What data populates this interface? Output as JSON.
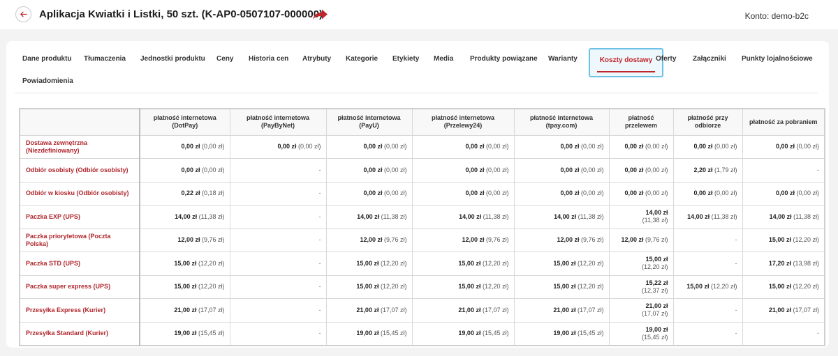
{
  "header": {
    "title": "Aplikacja Kwiatki i Listki, 50 szt. (K-AP0-0507107-000000)",
    "account": "Konto: demo-b2c",
    "back_icon": "arrow-left-icon",
    "share_icon": "share-arrow-icon",
    "accent": "#c0272d"
  },
  "tabs": [
    {
      "label": "Dane produktu"
    },
    {
      "label": "Tłumaczenia"
    },
    {
      "label": "Jednostki produktu"
    },
    {
      "label": "Ceny"
    },
    {
      "label": "Historia cen"
    },
    {
      "label": "Atrybuty"
    },
    {
      "label": "Kategorie"
    },
    {
      "label": "Etykiety"
    },
    {
      "label": "Media"
    },
    {
      "label": "Produkty powiązane"
    },
    {
      "label": "Warianty"
    },
    {
      "label": "Koszty dostawy",
      "active": true
    },
    {
      "label": "Oferty"
    },
    {
      "label": "Załączniki"
    },
    {
      "label": "Punkty lojalnościowe"
    },
    {
      "label": "Powiadomienia"
    }
  ],
  "table": {
    "columns": [
      "",
      "płatność internetowa (DotPay)",
      "płatność internetowa (PayByNet)",
      "płatność internetowa (PayU)",
      "płatność internetowa (Przelewy24)",
      "płatność internetowa (tpay.com)",
      "płatność przelewem",
      "płatność przy odbiorze",
      "płatność za pobraniem"
    ],
    "rows": [
      {
        "name": "Dostawa zewnętrzna (Niezdefiniowany)",
        "cells": [
          {
            "v": "0,00 zł",
            "n": "(0,00 zł)"
          },
          {
            "v": "0,00 zł",
            "n": "(0,00 zł)"
          },
          {
            "v": "0,00 zł",
            "n": "(0,00 zł)"
          },
          {
            "v": "0,00 zł",
            "n": "(0,00 zł)"
          },
          {
            "v": "0,00 zł",
            "n": "(0,00 zł)"
          },
          {
            "v": "0,00 zł",
            "n": "(0,00 zł)"
          },
          {
            "v": "0,00 zł",
            "n": "(0,00 zł)"
          },
          {
            "v": "0,00 zł",
            "n": "(0,00 zł)"
          }
        ]
      },
      {
        "name": "Odbiór osobisty (Odbiór osobisty)",
        "cells": [
          {
            "v": "0,00 zł",
            "n": "(0,00 zł)"
          },
          {
            "v": "-"
          },
          {
            "v": "0,00 zł",
            "n": "(0,00 zł)"
          },
          {
            "v": "0,00 zł",
            "n": "(0,00 zł)"
          },
          {
            "v": "0,00 zł",
            "n": "(0,00 zł)"
          },
          {
            "v": "0,00 zł",
            "n": "(0,00 zł)"
          },
          {
            "v": "2,20 zł",
            "n": "(1,79 zł)"
          },
          {
            "v": "-"
          }
        ]
      },
      {
        "name": "Odbiór w kiosku (Odbiór osobisty)",
        "cells": [
          {
            "v": "0,22 zł",
            "n": "(0,18 zł)"
          },
          {
            "v": "-"
          },
          {
            "v": "0,00 zł",
            "n": "(0,00 zł)"
          },
          {
            "v": "0,00 zł",
            "n": "(0,00 zł)"
          },
          {
            "v": "0,00 zł",
            "n": "(0,00 zł)"
          },
          {
            "v": "0,00 zł",
            "n": "(0,00 zł)"
          },
          {
            "v": "0,00 zł",
            "n": "(0,00 zł)"
          },
          {
            "v": "0,00 zł",
            "n": "(0,00 zł)"
          }
        ]
      },
      {
        "name": "Paczka EXP (UPS)",
        "cells": [
          {
            "v": "14,00 zł",
            "n": "(11,38 zł)"
          },
          {
            "v": "-"
          },
          {
            "v": "14,00 zł",
            "n": "(11,38 zł)"
          },
          {
            "v": "14,00 zł",
            "n": "(11,38 zł)"
          },
          {
            "v": "14,00 zł",
            "n": "(11,38 zł)"
          },
          {
            "v": "14,00 zł",
            "n": "(11,38 zł)",
            "wrap": true
          },
          {
            "v": "14,00 zł",
            "n": "(11,38 zł)"
          },
          {
            "v": "14,00 zł",
            "n": "(11,38 zł)"
          }
        ]
      },
      {
        "name": "Paczka priorytetowa (Poczta Polska)",
        "cells": [
          {
            "v": "12,00 zł",
            "n": "(9,76 zł)"
          },
          {
            "v": "-"
          },
          {
            "v": "12,00 zł",
            "n": "(9,76 zł)"
          },
          {
            "v": "12,00 zł",
            "n": "(9,76 zł)"
          },
          {
            "v": "12,00 zł",
            "n": "(9,76 zł)"
          },
          {
            "v": "12,00 zł",
            "n": "(9,76 zł)"
          },
          {
            "v": "-"
          },
          {
            "v": "15,00 zł",
            "n": "(12,20 zł)"
          }
        ]
      },
      {
        "name": "Paczka STD (UPS)",
        "cells": [
          {
            "v": "15,00 zł",
            "n": "(12,20 zł)"
          },
          {
            "v": "-"
          },
          {
            "v": "15,00 zł",
            "n": "(12,20 zł)"
          },
          {
            "v": "15,00 zł",
            "n": "(12,20 zł)"
          },
          {
            "v": "15,00 zł",
            "n": "(12,20 zł)"
          },
          {
            "v": "15,00 zł",
            "n": "(12,20 zł)",
            "wrap": true
          },
          {
            "v": "-"
          },
          {
            "v": "17,20 zł",
            "n": "(13,98 zł)"
          }
        ]
      },
      {
        "name": "Paczka super express (UPS)",
        "cells": [
          {
            "v": "15,00 zł",
            "n": "(12,20 zł)"
          },
          {
            "v": "-"
          },
          {
            "v": "15,00 zł",
            "n": "(12,20 zł)"
          },
          {
            "v": "15,00 zł",
            "n": "(12,20 zł)"
          },
          {
            "v": "15,00 zł",
            "n": "(12,20 zł)"
          },
          {
            "v": "15,22 zł",
            "n": "(12,37 zł)",
            "wrap": true
          },
          {
            "v": "15,00 zł",
            "n": "(12,20 zł)"
          },
          {
            "v": "15,00 zł",
            "n": "(12,20 zł)"
          }
        ]
      },
      {
        "name": "Przesyłka Express (Kurier)",
        "cells": [
          {
            "v": "21,00 zł",
            "n": "(17,07 zł)"
          },
          {
            "v": "-"
          },
          {
            "v": "21,00 zł",
            "n": "(17,07 zł)"
          },
          {
            "v": "21,00 zł",
            "n": "(17,07 zł)"
          },
          {
            "v": "21,00 zł",
            "n": "(17,07 zł)"
          },
          {
            "v": "21,00 zł",
            "n": "(17,07 zł)",
            "wrap": true
          },
          {
            "v": "-"
          },
          {
            "v": "21,00 zł",
            "n": "(17,07 zł)"
          }
        ]
      },
      {
        "name": "Przesyłka Standard (Kurier)",
        "cells": [
          {
            "v": "19,00 zł",
            "n": "(15,45 zł)"
          },
          {
            "v": "-"
          },
          {
            "v": "19,00 zł",
            "n": "(15,45 zł)"
          },
          {
            "v": "19,00 zł",
            "n": "(15,45 zł)"
          },
          {
            "v": "19,00 zł",
            "n": "(15,45 zł)"
          },
          {
            "v": "19,00 zł",
            "n": "(15,45 zł)",
            "wrap": true
          },
          {
            "v": "-"
          },
          {
            "v": "-"
          }
        ]
      }
    ]
  }
}
